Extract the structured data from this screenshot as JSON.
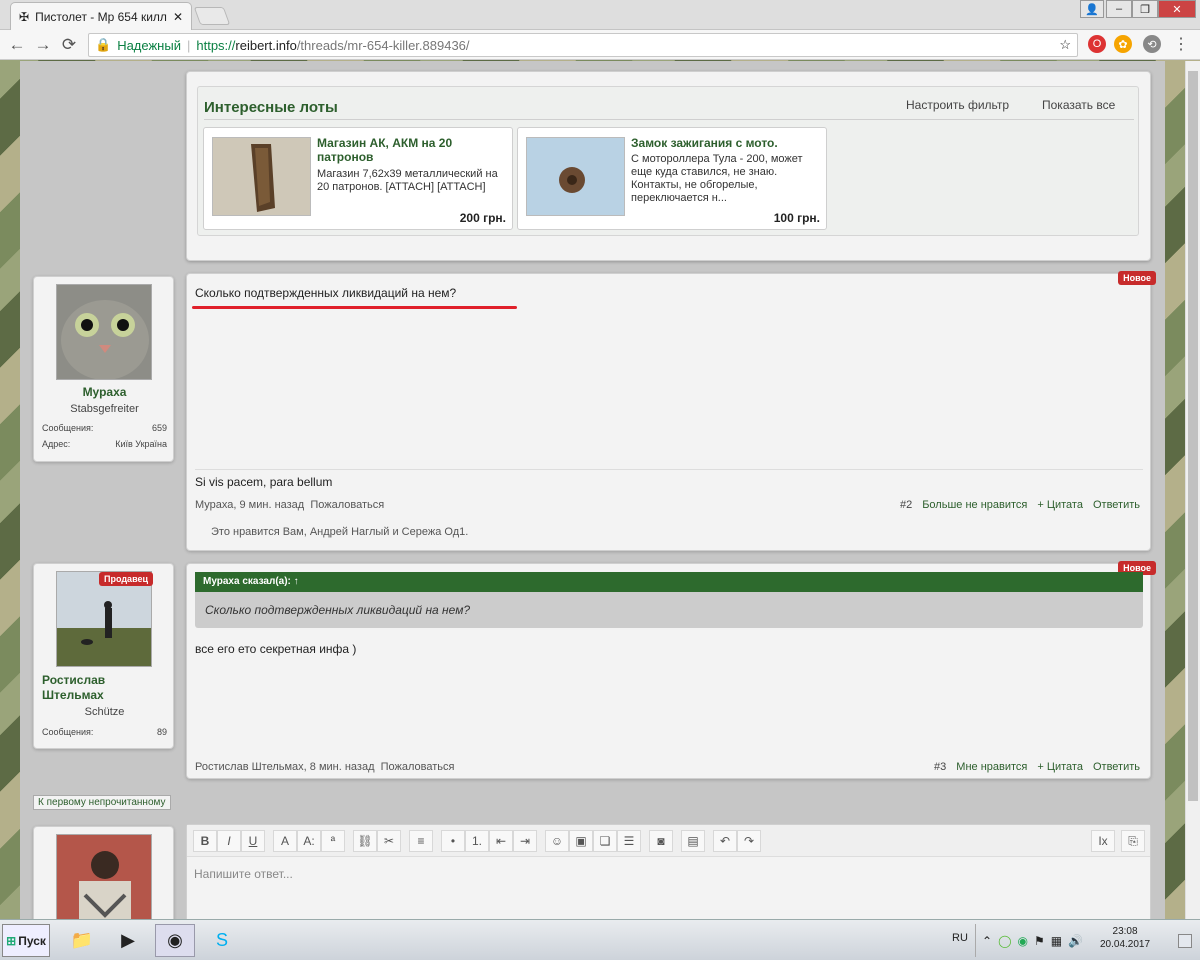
{
  "browser": {
    "tab_title": "Пистолет - Мр 654 килл",
    "secure_label": "Надежный",
    "url_proto": "https://",
    "url_host": "reibert.info",
    "url_path": "/threads/mr-654-killer.889436/"
  },
  "lots": {
    "title": "Интересные лоты",
    "configure_filter": "Настроить фильтр",
    "show_all": "Показать все",
    "items": [
      {
        "title": "Магазин АК, АКМ на 20 патронов",
        "desc": "Магазин 7,62х39 металлический на 20 патронов. [ATTACH] [ATTACH]",
        "price": "200 грн."
      },
      {
        "title": "Замок зажигания с мото.",
        "desc": "С мотороллера Тула - 200, может еще куда ставился, не знаю. Контакты, не обгорелые, переключается н...",
        "price": "100 грн."
      }
    ]
  },
  "post2": {
    "user": {
      "name": "Мураха",
      "title": "Stabsgefreiter",
      "msgs_label": "Сообщения:",
      "msgs": "659",
      "addr_label": "Адрес:",
      "addr": "Київ Україна"
    },
    "badge": "Новое",
    "text": "Сколько подтвержденных ликвидаций на нем?",
    "signature": "Si vis pacem, para bellum",
    "meta": "Мураха, 9 мин. назад",
    "report": "Пожаловаться",
    "num": "#2",
    "unlike": "Больше не нравится",
    "quote": "+ Цитата",
    "reply": "Ответить",
    "likes": "Это нравится Вам, Андрей Наглый и Сережа Од1."
  },
  "post3": {
    "user": {
      "name": "Ростислав Штельмах",
      "title": "Schütze",
      "msgs_label": "Сообщения:",
      "msgs": "89",
      "seller": "Продавец"
    },
    "badge": "Новое",
    "quote_head": "Мураха сказал(а): ↑",
    "quote_text": "Сколько подтвержденных ликвидаций на нем?",
    "text": "все его ето секретная инфа )",
    "meta": "Ростислав Штельмах, 8 мин. назад",
    "report": "Пожаловаться",
    "num": "#3",
    "like": "Мне нравится",
    "quote": "+ Цитата",
    "reply": "Ответить"
  },
  "first_unread": "К первому непрочитанному",
  "editor": {
    "placeholder": "Напишите ответ..."
  },
  "taskbar": {
    "start": "Пуск",
    "lang": "RU",
    "time": "23:08",
    "date": "20.04.2017"
  }
}
